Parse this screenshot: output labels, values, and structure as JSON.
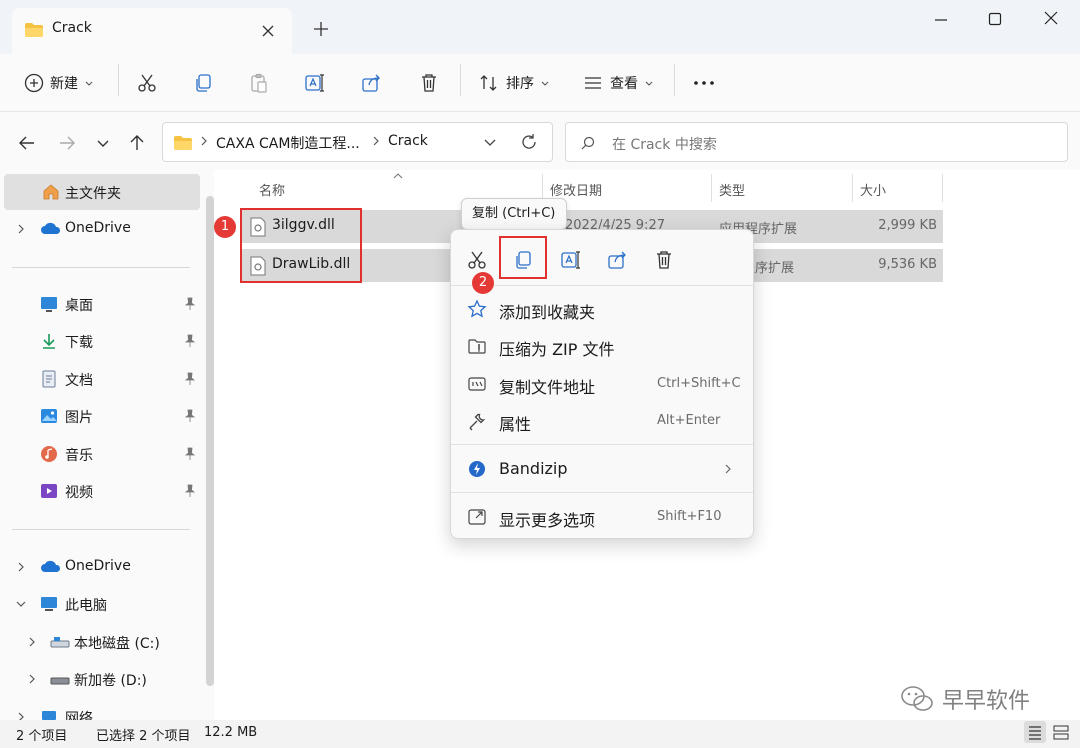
{
  "tab": {
    "title": "Crack"
  },
  "toolbar": {
    "new_label": "新建",
    "sort_label": "排序",
    "view_label": "查看"
  },
  "address": {
    "crumbs": [
      "CAXA CAM制造工程...",
      "Crack"
    ]
  },
  "search": {
    "placeholder": "在 Crack 中搜索"
  },
  "sidebar": {
    "items": [
      {
        "label": "主文件夹"
      },
      {
        "label": "OneDrive"
      },
      {
        "label": "桌面"
      },
      {
        "label": "下载"
      },
      {
        "label": "文档"
      },
      {
        "label": "图片"
      },
      {
        "label": "音乐"
      },
      {
        "label": "视频"
      },
      {
        "label": "OneDrive"
      },
      {
        "label": "此电脑"
      },
      {
        "label": "本地磁盘 (C:)"
      },
      {
        "label": "新加卷 (D:)"
      },
      {
        "label": "网络"
      }
    ]
  },
  "columns": {
    "name": "名称",
    "modified": "修改日期",
    "type": "类型",
    "size": "大小"
  },
  "files": [
    {
      "name": "3ilggv.dll",
      "date": "2022/4/25 9:27",
      "type": "应用程序扩展",
      "size": "2,999 KB"
    },
    {
      "name": "DrawLib.dll",
      "date": "",
      "type": "程序扩展",
      "size": "9,536 KB"
    }
  ],
  "tooltip": {
    "text": "复制 (Ctrl+C)"
  },
  "context_menu": {
    "items": [
      {
        "label": "添加到收藏夹",
        "shortcut": ""
      },
      {
        "label": "压缩为 ZIP 文件",
        "shortcut": ""
      },
      {
        "label": "复制文件地址",
        "shortcut": "Ctrl+Shift+C"
      },
      {
        "label": "属性",
        "shortcut": "Alt+Enter"
      },
      {
        "label": "Bandizip",
        "shortcut": ""
      },
      {
        "label": "显示更多选项",
        "shortcut": "Shift+F10"
      }
    ]
  },
  "annotations": {
    "badge1": "1",
    "badge2": "2"
  },
  "status": {
    "count": "2 个项目",
    "selected": "已选择 2 个项目",
    "size": "12.2 MB"
  },
  "watermark": {
    "text": "早早软件"
  },
  "colors": {
    "accent": "#0067c0",
    "highlight_box": "#e03030",
    "selection": "#d9d9d9"
  }
}
